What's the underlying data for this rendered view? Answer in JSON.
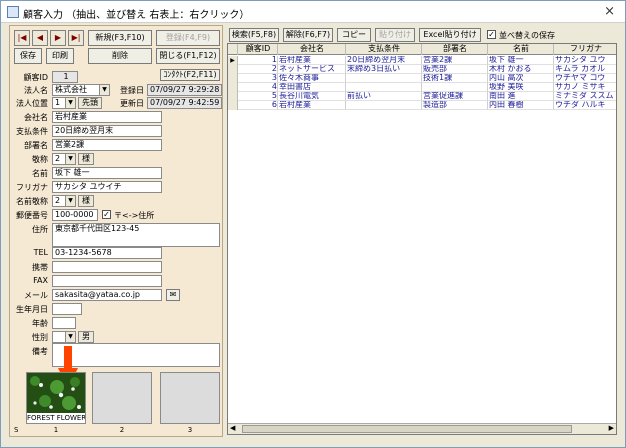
{
  "window": {
    "title": "顧客入力 （抽出、並び替え 右表上：右クリック）",
    "close": "×"
  },
  "nav": {
    "first": "|◀",
    "prev": "◀",
    "next": "▶",
    "last": "▶|"
  },
  "buttons": {
    "new": "新規(F3,F10)",
    "register": "登録(F4,F9)",
    "save": "保存",
    "print": "印刷",
    "delete": "削除",
    "close": "閉じる(F1,F12)",
    "contact": "ｺﾝﾀｸﾄ(F2,F11)"
  },
  "form": {
    "customer_id_label": "顧客ID",
    "customer_id": "1",
    "corp_name_label": "法人名",
    "corp_name": "株式会社",
    "corp_pos_label": "法人位置",
    "corp_pos": "1",
    "corp_pos_tag": "先頭",
    "reg_date_label": "登録日",
    "reg_date": "07/09/27 9:29:28",
    "upd_date_label": "更新日",
    "upd_date": "07/09/27 9:42:59",
    "company_label": "会社名",
    "company": "岩村産業",
    "payment_label": "支払条件",
    "payment": "20日締め翌月末",
    "dept_label": "部署名",
    "dept": "営業2課",
    "honorific_label": "敬称",
    "honorific": "2",
    "honorific_tag": "様",
    "name_label": "名前",
    "name": "坂下 雄一",
    "furigana_label": "フリガナ",
    "furigana": "サカシタ ユウイチ",
    "name_honorific_label": "名前敬称",
    "name_honorific": "2",
    "name_honorific_tag": "様",
    "zip_label": "郵便番号",
    "zip": "100-0000",
    "zip_check_label": "〒<->住所",
    "zip_check": "✓",
    "address_label": "住所",
    "address": "東京都千代田区123-45",
    "tel_label": "TEL",
    "tel": "03-1234-5678",
    "mobile_label": "携帯",
    "mobile": "",
    "fax_label": "FAX",
    "fax": "",
    "mail_label": "メール",
    "mail": "sakasita@yataa.co.jp",
    "birth_label": "生年月日",
    "birth": "",
    "age_label": "年齢",
    "age": "",
    "gender_label": "性別",
    "gender": "",
    "gender_tag": "男",
    "notes_label": "備考",
    "notes": ""
  },
  "thumbs": [
    {
      "caption": "FOREST FLOWER",
      "num": "1"
    },
    {
      "caption": "",
      "num": "2"
    },
    {
      "caption": "",
      "num": "3"
    }
  ],
  "thumb_s": "S",
  "toolbar": {
    "search": "検索(F5,F8)",
    "clear": "解除(F6,F7)",
    "copy": "コピー",
    "paste": "貼り付け",
    "excel_paste": "Excel貼り付け",
    "keep_sort_label": "並べ替えの保存",
    "keep_sort": "✓"
  },
  "grid": {
    "columns": [
      "顧客ID",
      "会社名",
      "支払条件",
      "部署名",
      "名前",
      "フリガナ"
    ],
    "rows": [
      [
        "1",
        "岩村産業",
        "20日締め翌月末",
        "営業2課",
        "坂下 雄一",
        "サカシタ ユウ"
      ],
      [
        "2",
        "ネットサービス",
        "末締め3日払い",
        "販売部",
        "木村 かおる",
        "キムラ カオル"
      ],
      [
        "3",
        "佐々木商事",
        "",
        "技術1課",
        "内山 高次",
        "ウチヤマ コウ"
      ],
      [
        "4",
        "幸田書店",
        "",
        "",
        "坂野 美咲",
        "サカノ ミサキ"
      ],
      [
        "5",
        "長谷川電気",
        "前払い",
        "営業促進課",
        "南田 進",
        "ミナミダ ススム"
      ],
      [
        "6",
        "岩村産業",
        "",
        "製造部",
        "内田 春樹",
        "ウチダ ハルキ"
      ]
    ]
  },
  "colors": {
    "accent_arrow": "#ff4400",
    "grid_text": "#20209a"
  }
}
